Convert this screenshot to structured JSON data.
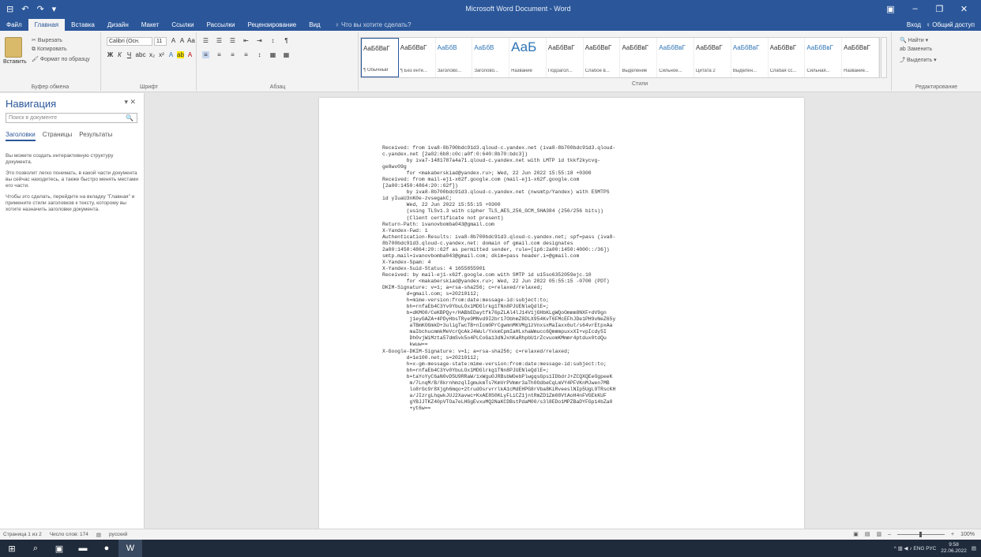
{
  "titlebar": {
    "title": "Microsoft Word Document - Word",
    "qat": [
      "⊟",
      "↶",
      "↷",
      "▾"
    ],
    "controls": [
      "▣",
      "–",
      "❐",
      "✕"
    ]
  },
  "tabs": {
    "items": [
      "Файл",
      "Главная",
      "Вставка",
      "Дизайн",
      "Макет",
      "Ссылки",
      "Рассылки",
      "Рецензирование",
      "Вид"
    ],
    "active_index": 1,
    "tellme": "♀ Что вы хотите сделать?",
    "signin": "Вход",
    "share": "♀ Общий доступ"
  },
  "ribbon": {
    "clipboard": {
      "paste": "Вставить",
      "cut": "✂ Вырезать",
      "copy": "⧉ Копировать",
      "format_painter": "🖌 Формат по образцу",
      "label": "Буфер обмена"
    },
    "font": {
      "name": "Calibri (Осн.",
      "size": "11",
      "label": "Шрифт",
      "row1": [
        "A",
        "A",
        "Aa",
        "A"
      ],
      "row2": [
        "Ж",
        "К",
        "Ч",
        "abc",
        "x₂",
        "x²",
        "A",
        "ab",
        "A"
      ]
    },
    "paragraph": {
      "label": "Абзац",
      "row1": [
        "☰",
        "☰",
        "☰",
        "⇤",
        "⇥",
        "↕",
        "¶"
      ],
      "row2": [
        "≡",
        "≡",
        "≡",
        "≡",
        "↕",
        "▦",
        "▦"
      ]
    },
    "styles": {
      "label": "Стили",
      "items": [
        {
          "sample": "АаБбВвГ",
          "name": "¶ Обычный"
        },
        {
          "sample": "АаБбВвГ",
          "name": "¶ Без инте..."
        },
        {
          "sample": "АаБбВ",
          "name": "Заголово..."
        },
        {
          "sample": "АаБбВ",
          "name": "Заголово..."
        },
        {
          "sample": "АаБ",
          "name": "Название"
        },
        {
          "sample": "АаБбВвГ",
          "name": "Подзагол..."
        },
        {
          "sample": "АаБбВвГ",
          "name": "Слабое в..."
        },
        {
          "sample": "АаБбВвГ",
          "name": "Выделение"
        },
        {
          "sample": "АаБбВвГ",
          "name": "Сильное..."
        },
        {
          "sample": "АаБбВвГ",
          "name": "Цитата 2"
        },
        {
          "sample": "АаБбВвГ",
          "name": "Выделен..."
        },
        {
          "sample": "АаБбВвГ",
          "name": "Слабая сс..."
        },
        {
          "sample": "АаБбВвГ",
          "name": "Сильная..."
        },
        {
          "sample": "АаБбВвГ",
          "name": "Название..."
        }
      ]
    },
    "editing": {
      "find": "🔍 Найти ▾",
      "replace": "ab Заменить",
      "select": "⤴ Выделить ▾",
      "label": "Редактирование"
    }
  },
  "nav": {
    "title": "Навигация",
    "close": "▾ ✕",
    "search_placeholder": "Поиск в документе",
    "search_icon": "🔍",
    "tabs": [
      "Заголовки",
      "Страницы",
      "Результаты"
    ],
    "paragraphs": [
      "Вы можете создать интерактивную структуру документа.",
      "Это позволит легко понимать, в какой части документа вы сейчас находитесь, а также быстро менять местами его части.",
      "Чтобы это сделать, перейдите на вкладку \"Главная\" и примените стили заголовков к тексту, которому вы хотите назначить заголовки документа."
    ]
  },
  "document": {
    "lines": [
      "Received: from iva8-8b700bdc91d3.qloud-c.yandex.net (iva8-8b700bdc91d3.qloud-",
      "c.yandex.net [2a02:6b8:c0c:a0f:0:640:8b70:bdc3])",
      "        by iva7-1481787a4a71.qloud-c.yandex.net with LMTP id tkkf2kycvg-",
      "ge8wv09g",
      "        for <makaberskiad@yandex.ru>; Wed, 22 Jun 2022 15:55:18 +0300",
      "Received: from mail-ej1-x62f.google.com (mail-ej1-x62f.google.com",
      "[2a00:1450:4864:20::62f])",
      "        by iva8-8b700bdc91d3.qloud-c.yandex.net (nwsmtp/Yandex) with ESMTPS",
      "id yIuaU3nK0e-zvsegakC;",
      "        Wed, 22 Jun 2022 15:55:15 +0300",
      "        (using TLSv1.3 with cipher TLS_AES_256_GCM_SHA384 (256/256 bits))",
      "        (Client certificate not present)",
      "Return-Path: ivanovbomba043@gmail.com",
      "X-Yandex-Fwd: 1",
      "Authentication-Results: iva8-8b700bdc91d3.qloud-c.yandex.net; spf=pass (iva8-",
      "8b700bdc91d3.qloud-c.yandex.net: domain of gmail.com designates",
      "2a00:1450:4864:20::62f as permitted sender, rule=[ip6:2a00:1450:4000::/36])",
      "smtp.mail=ivanovbomba043@gmail.com; dkim=pass header.i=@gmail.com",
      "X-Yandex-Spam: 4",
      "X-Yandex-Suid-Status: 4 1655855901",
      "Received: by mail-ej1-x62f.google.com with SMTP id u15so6352059ejc.10",
      "        for <makaberskiad@yandex.ru>; Wed, 22 Jun 2022 05:55:15 -0700 (PDT)",
      "DKIM-Signature: v=1; a=rsa-sha256; c=relaxed/relaxed;",
      "        d=gmail.com; s=20210112;",
      "        h=mime-version:from:date:message-id:subject:to;",
      "        bh=rnfaEb4C3Yv0YbuLOx1MDGlrkg1TNn8PJUENleQdlE=;",
      "        b=dKMO0/CeKBPQy+/HABbEDaytfk76pZLAl4lJ14V1jGHbKLgWQoOmmm8NXF+dV9gn",
      "         j1eyGAZA+4PDyHbsTRye9MNvd9I2br17ObhmZ8DLX954KvT6FMcEFhJDe1PH9vNeZ65y",
      "         aTBmKOGmkD+3uligTwcTB+nIcm0PrCgwmnMKVMg1zVnxsxMaIaxx6ut/s64vrEtpxAa",
      "         maIbchucmmkMeVcrQcAkJ4Wul/YxkmCpmIaHLxhaWmucc6QmmmpuxxXI+vpIcdy5I",
      "         Dh0vjWiMzta57dmSvk5o4PLCoGa13dNJxhKaRhpbU1rZcvuomKMmmr4ptdux0tdQu",
      "         kwuw==",
      "X-Google-DKIM-Signature: v=1; a=rsa-sha256; c=relaxed/relaxed;",
      "        d=1e100.net; s=20210112;",
      "        h=x-gm-message-state:mime-version:from:date:message-id:subject:to;",
      "        bh=rnfaEb4C3Yv0YbuLOx1MDGlrkg1TNn8PJUENleQdlE=;",
      "        b=taYoYyC6aN0vD5U9RRaW/1xWgu0JRBsbWOebPlwgqsGps1IDbdrJ+ZCQXQEeOgpeeK",
      "         m/7LnqM/B/8krnhmzqlIgmukmTs7KmVrPVmmr3aTh0OdbeCqLmVY4PFVKnMJwen7MB",
      "         lo8rGc9r8Xjgh6mqo+2trudOsrvrrlkA1cMdEHPG8rVba8KiRveeslNIp5UgL9TRscKH",
      "         a/JIzrgLhqwkJUJ2Xavwc+KxAE8S0KLyFLiCZ1jntRmZD1Zm08VtAoH4nFVGEkKUF",
      "         gYBJJTKZ40pVTOa7eLHGgEvxuMQ2NaKCDBstPdaM00/s3l8EDo1MPZBaDYFGp14bZa0",
      "         +yt6w=="
    ]
  },
  "status": {
    "page": "Страница 1 из 2",
    "words": "Число слов: 174",
    "lang_icon": "▤",
    "lang": "русский",
    "view_icons": [
      "▣",
      "▤",
      "▥"
    ],
    "zoom_minus": "–",
    "zoom_plus": "+",
    "zoom": "100%"
  },
  "taskbar": {
    "items": [
      "⊞",
      "⌕",
      "▣",
      "▬",
      "●",
      "W"
    ],
    "active_index": 5,
    "tray": "^ ▥ ◀ ♪ ENG РУС",
    "time": "9:58",
    "date": "22.06.2022",
    "notify": "▤"
  }
}
